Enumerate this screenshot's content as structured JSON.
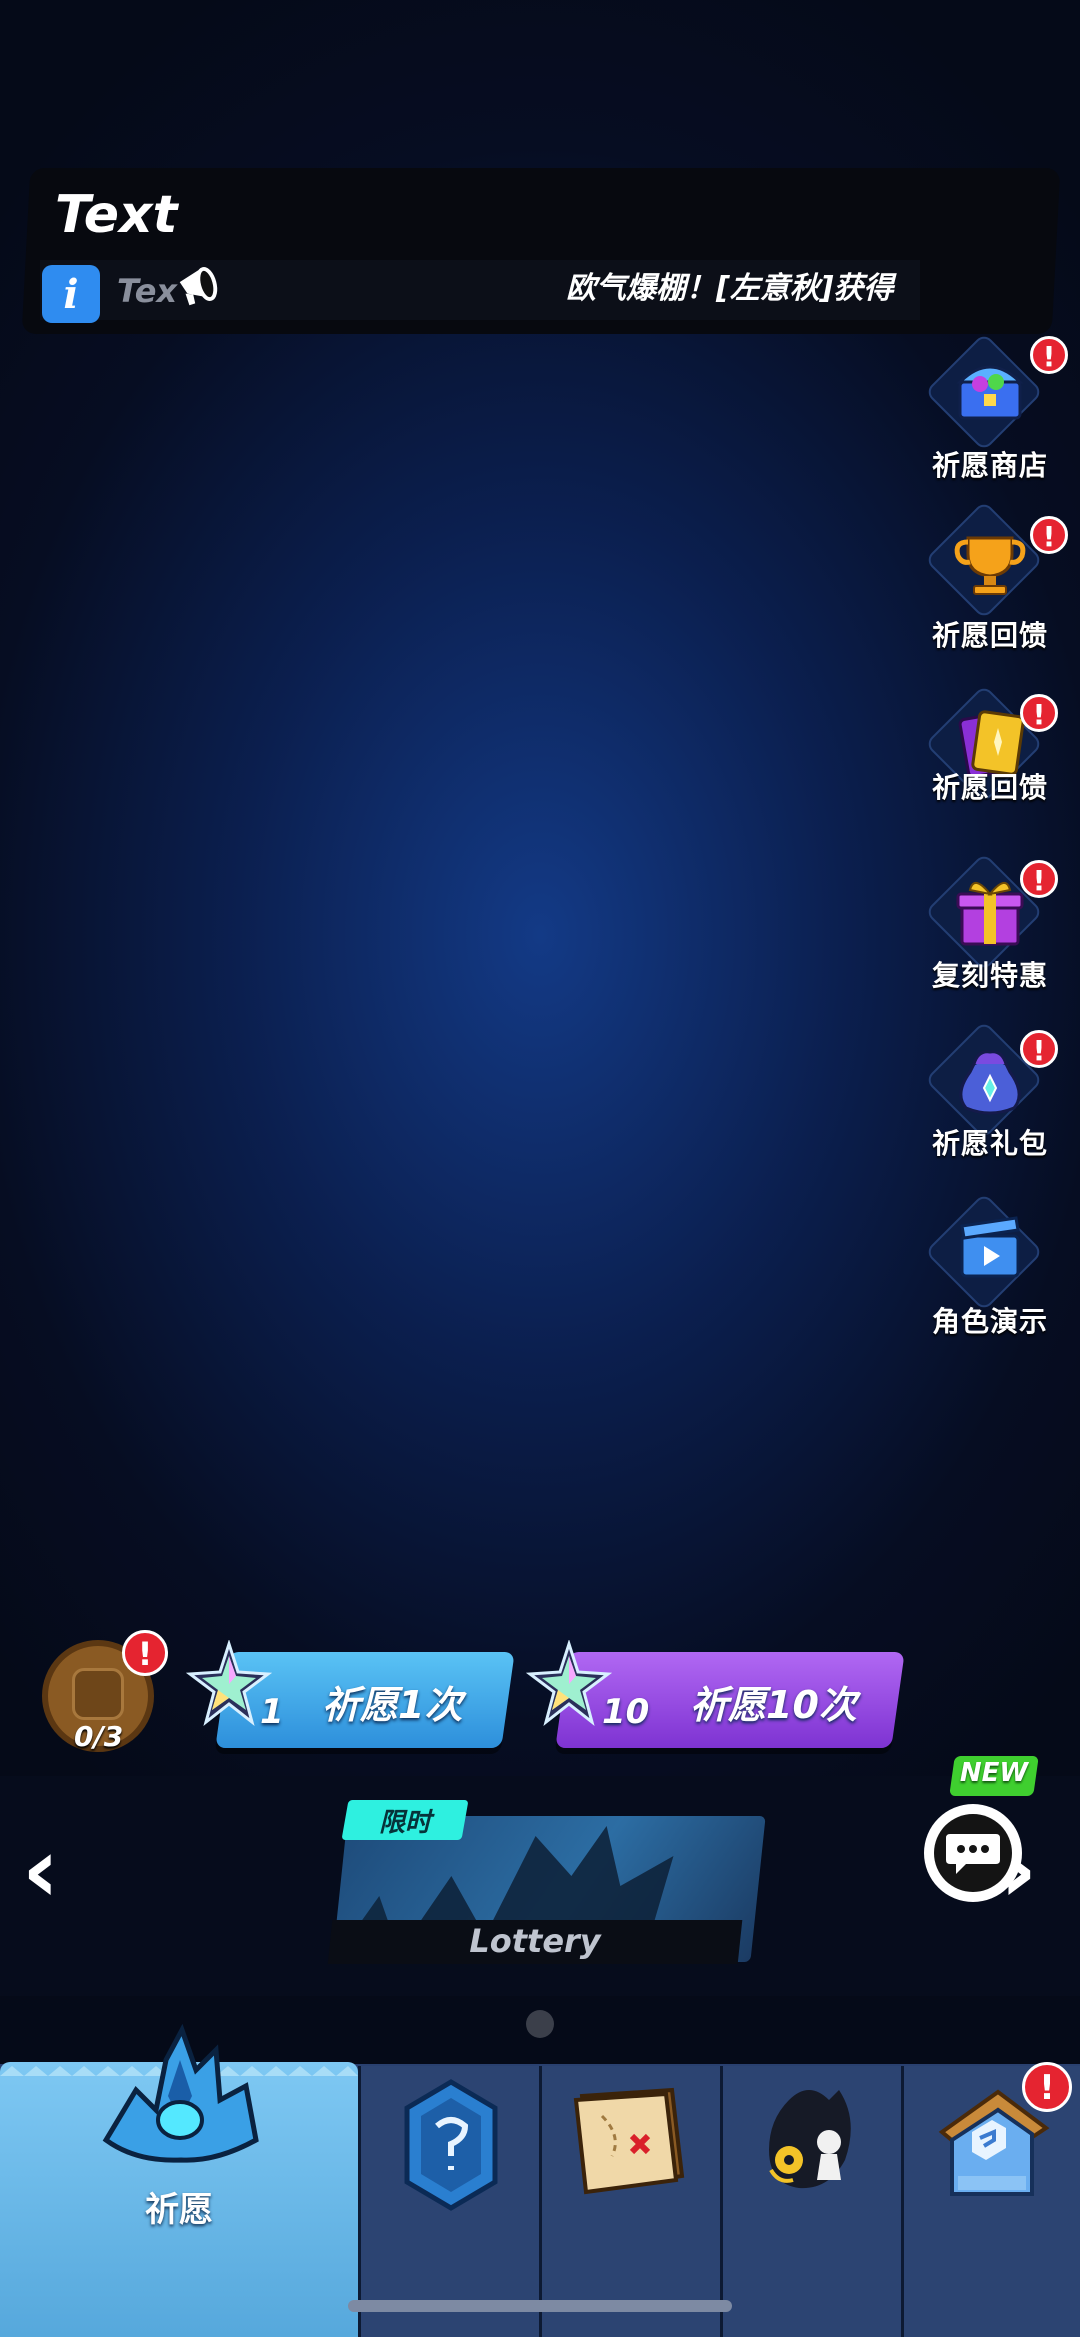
{
  "header": {
    "title": "Text",
    "info_text": "Tex",
    "marquee": "欧气爆棚！[左意秋]获得"
  },
  "side_menu": [
    {
      "label": "祈愿商店",
      "icon": "treasure-chest-icon",
      "alert": "!"
    },
    {
      "label": "祈愿回馈",
      "icon": "trophy-icon",
      "alert": "!"
    },
    {
      "label": "祈愿回馈",
      "icon": "card-icon",
      "alert": "!"
    },
    {
      "label": "复刻特惠",
      "icon": "gift-box-icon",
      "alert": "!"
    },
    {
      "label": "祈愿礼包",
      "icon": "pouch-icon",
      "alert": "!"
    },
    {
      "label": "角色演示",
      "icon": "video-play-icon",
      "alert": ""
    }
  ],
  "wish": {
    "progress": "0/3",
    "alert": "!",
    "single": {
      "count": "1",
      "label": "祈愿1次"
    },
    "ten": {
      "count": "10",
      "label": "祈愿10次"
    }
  },
  "carousel": {
    "tag": "限时",
    "card_label": "Lottery",
    "new_badge": "NEW",
    "prev": "‹",
    "next": "›"
  },
  "tabbar": {
    "active_label": "祈愿",
    "alert": "!"
  },
  "colors": {
    "single_button": "#3aa7ea",
    "ten_button": "#9a4ce6",
    "alert": "#e52430",
    "active_tab": "#6bb9ea"
  }
}
